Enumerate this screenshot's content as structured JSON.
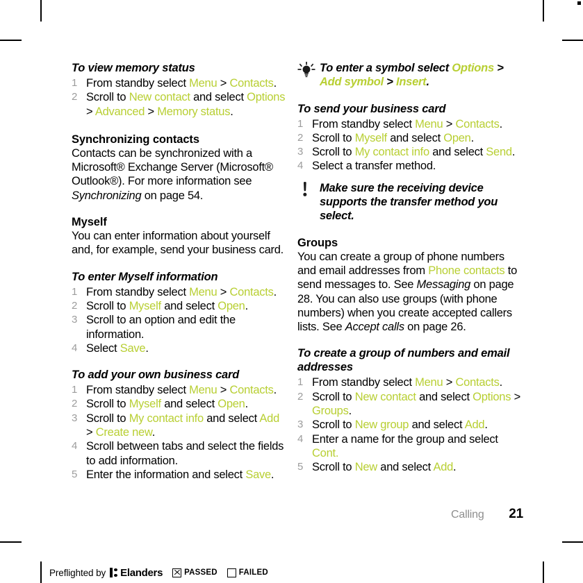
{
  "colors": {
    "accent_green": "#b8cf33",
    "step_number_grey": "#9c9c9c",
    "chapter_grey": "#8e8e8e"
  },
  "footer": {
    "chapter": "Calling",
    "page_number": "21"
  },
  "preflight": {
    "label": "Preflighted by",
    "brand": "Elanders",
    "passed_label": "PASSED",
    "failed_label": "FAILED",
    "passed_checked": true,
    "failed_checked": false
  },
  "left_column": {
    "proc_memory_status": {
      "heading": "To view memory status",
      "steps": [
        [
          {
            "t": "From standby select ",
            "c": "black"
          },
          {
            "t": "Menu",
            "c": "green"
          },
          {
            "t": " > ",
            "c": "black"
          },
          {
            "t": "Contacts",
            "c": "green"
          },
          {
            "t": ".",
            "c": "black"
          }
        ],
        [
          {
            "t": "Scroll to ",
            "c": "black"
          },
          {
            "t": "New contact",
            "c": "green"
          },
          {
            "t": " and select ",
            "c": "black"
          },
          {
            "t": "Options",
            "c": "green"
          },
          {
            "t": " > ",
            "c": "black"
          },
          {
            "t": "Advanced",
            "c": "green"
          },
          {
            "t": " > ",
            "c": "black"
          },
          {
            "t": "Memory status",
            "c": "green"
          },
          {
            "t": ".",
            "c": "black"
          }
        ]
      ]
    },
    "sec_synchronizing": {
      "heading": "Synchronizing contacts",
      "body": [
        {
          "t": "Contacts can be synchronized with a Microsoft® Exchange Server (Microsoft® Outlook®). For more information see ",
          "c": "black"
        },
        {
          "t": "Synchronizing",
          "c": "italic"
        },
        {
          "t": " on page 54.",
          "c": "black"
        }
      ]
    },
    "sec_myself": {
      "heading": "Myself",
      "body": [
        {
          "t": "You can enter information about yourself and, for example, send your business card.",
          "c": "black"
        }
      ]
    },
    "proc_myself_info": {
      "heading": "To enter Myself information",
      "steps": [
        [
          {
            "t": "From standby select ",
            "c": "black"
          },
          {
            "t": "Menu",
            "c": "green"
          },
          {
            "t": " > ",
            "c": "black"
          },
          {
            "t": "Contacts",
            "c": "green"
          },
          {
            "t": ".",
            "c": "black"
          }
        ],
        [
          {
            "t": "Scroll to ",
            "c": "black"
          },
          {
            "t": "Myself",
            "c": "green"
          },
          {
            "t": " and select ",
            "c": "black"
          },
          {
            "t": "Open",
            "c": "green"
          },
          {
            "t": ".",
            "c": "black"
          }
        ],
        [
          {
            "t": "Scroll to an option and edit the information.",
            "c": "black"
          }
        ],
        [
          {
            "t": "Select ",
            "c": "black"
          },
          {
            "t": "Save",
            "c": "green"
          },
          {
            "t": ".",
            "c": "black"
          }
        ]
      ]
    },
    "proc_add_business_card": {
      "heading": "To add your own business card",
      "steps": [
        [
          {
            "t": "From standby select ",
            "c": "black"
          },
          {
            "t": "Menu",
            "c": "green"
          },
          {
            "t": " > ",
            "c": "black"
          },
          {
            "t": "Contacts",
            "c": "green"
          },
          {
            "t": ".",
            "c": "black"
          }
        ],
        [
          {
            "t": "Scroll to ",
            "c": "black"
          },
          {
            "t": "Myself",
            "c": "green"
          },
          {
            "t": " and select ",
            "c": "black"
          },
          {
            "t": "Open",
            "c": "green"
          },
          {
            "t": ".",
            "c": "black"
          }
        ],
        [
          {
            "t": "Scroll to ",
            "c": "black"
          },
          {
            "t": "My contact info",
            "c": "green"
          },
          {
            "t": " and select ",
            "c": "black"
          },
          {
            "t": "Add",
            "c": "green"
          },
          {
            "t": " > ",
            "c": "black"
          },
          {
            "t": "Create new",
            "c": "green"
          },
          {
            "t": ".",
            "c": "black"
          }
        ],
        [
          {
            "t": "Scroll between tabs and select the fields to add information.",
            "c": "black"
          }
        ],
        [
          {
            "t": "Enter the information and select ",
            "c": "black"
          },
          {
            "t": "Save",
            "c": "green"
          },
          {
            "t": ".",
            "c": "black"
          }
        ]
      ]
    }
  },
  "right_column": {
    "tip_symbol": {
      "icon": "lightbulb-tip-icon",
      "text": [
        {
          "t": "To enter a symbol select ",
          "c": "black"
        },
        {
          "t": "Options",
          "c": "green"
        },
        {
          "t": " > ",
          "c": "black"
        },
        {
          "t": "Add symbol",
          "c": "green"
        },
        {
          "t": " > ",
          "c": "black"
        },
        {
          "t": "Insert",
          "c": "green"
        },
        {
          "t": ".",
          "c": "black"
        }
      ]
    },
    "proc_send_business_card": {
      "heading": "To send your business card",
      "steps": [
        [
          {
            "t": "From standby select ",
            "c": "black"
          },
          {
            "t": "Menu",
            "c": "green"
          },
          {
            "t": " > ",
            "c": "black"
          },
          {
            "t": "Contacts",
            "c": "green"
          },
          {
            "t": ".",
            "c": "black"
          }
        ],
        [
          {
            "t": "Scroll to ",
            "c": "black"
          },
          {
            "t": "Myself",
            "c": "green"
          },
          {
            "t": " and select ",
            "c": "black"
          },
          {
            "t": "Open",
            "c": "green"
          },
          {
            "t": ".",
            "c": "black"
          }
        ],
        [
          {
            "t": "Scroll to ",
            "c": "black"
          },
          {
            "t": "My contact info",
            "c": "green"
          },
          {
            "t": " and select ",
            "c": "black"
          },
          {
            "t": "Send",
            "c": "green"
          },
          {
            "t": ".",
            "c": "black"
          }
        ],
        [
          {
            "t": "Select a transfer method.",
            "c": "black"
          }
        ]
      ]
    },
    "note_transfer": {
      "icon": "exclamation-note-icon",
      "text": [
        {
          "t": "Make sure the receiving device supports the transfer method you select.",
          "c": "black"
        }
      ]
    },
    "sec_groups": {
      "heading": "Groups",
      "body": [
        {
          "t": "You can create a group of phone numbers and email addresses from ",
          "c": "black"
        },
        {
          "t": "Phone contacts",
          "c": "green"
        },
        {
          "t": " to send messages to. See ",
          "c": "black"
        },
        {
          "t": "Messaging",
          "c": "italic"
        },
        {
          "t": " on page 28. You can also use groups (with phone numbers) when you create accepted callers lists. See ",
          "c": "black"
        },
        {
          "t": "Accept calls",
          "c": "italic"
        },
        {
          "t": " on page 26.",
          "c": "black"
        }
      ]
    },
    "proc_create_group": {
      "heading": "To create a group of numbers and email addresses",
      "steps": [
        [
          {
            "t": "From standby select ",
            "c": "black"
          },
          {
            "t": "Menu",
            "c": "green"
          },
          {
            "t": " > ",
            "c": "black"
          },
          {
            "t": "Contacts",
            "c": "green"
          },
          {
            "t": ".",
            "c": "black"
          }
        ],
        [
          {
            "t": "Scroll to ",
            "c": "black"
          },
          {
            "t": "New contact",
            "c": "green"
          },
          {
            "t": " and select ",
            "c": "black"
          },
          {
            "t": "Options",
            "c": "green"
          },
          {
            "t": " > ",
            "c": "black"
          },
          {
            "t": "Groups",
            "c": "green"
          },
          {
            "t": ".",
            "c": "black"
          }
        ],
        [
          {
            "t": "Scroll to ",
            "c": "black"
          },
          {
            "t": "New group",
            "c": "green"
          },
          {
            "t": " and select ",
            "c": "black"
          },
          {
            "t": "Add",
            "c": "green"
          },
          {
            "t": ".",
            "c": "black"
          }
        ],
        [
          {
            "t": "Enter a name for the group and select ",
            "c": "black"
          },
          {
            "t": "Cont.",
            "c": "green"
          }
        ],
        [
          {
            "t": "Scroll to ",
            "c": "black"
          },
          {
            "t": "New",
            "c": "green"
          },
          {
            "t": " and select ",
            "c": "black"
          },
          {
            "t": "Add",
            "c": "green"
          },
          {
            "t": ".",
            "c": "black"
          }
        ]
      ]
    }
  }
}
